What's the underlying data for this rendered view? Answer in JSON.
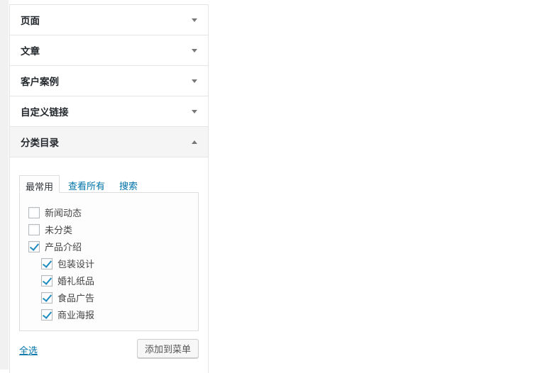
{
  "sections": [
    {
      "label": "页面",
      "open": false
    },
    {
      "label": "文章",
      "open": false
    },
    {
      "label": "客户案例",
      "open": false
    },
    {
      "label": "自定义链接",
      "open": false
    },
    {
      "label": "分类目录",
      "open": true
    }
  ],
  "tabs": [
    {
      "label": "最常用",
      "active": true
    },
    {
      "label": "查看所有"
    },
    {
      "label": "搜索"
    }
  ],
  "categories": [
    {
      "label": "新闻动态",
      "checked": false,
      "level": 0
    },
    {
      "label": "未分类",
      "checked": false,
      "level": 0
    },
    {
      "label": "产品介绍",
      "checked": true,
      "level": 0
    },
    {
      "label": "包装设计",
      "checked": true,
      "level": 1
    },
    {
      "label": "婚礼纸品",
      "checked": true,
      "level": 1
    },
    {
      "label": "食品广告",
      "checked": true,
      "level": 1
    },
    {
      "label": "商业海报",
      "checked": true,
      "level": 1
    }
  ],
  "select_all": "全选",
  "add_to_menu": "添加到菜单"
}
